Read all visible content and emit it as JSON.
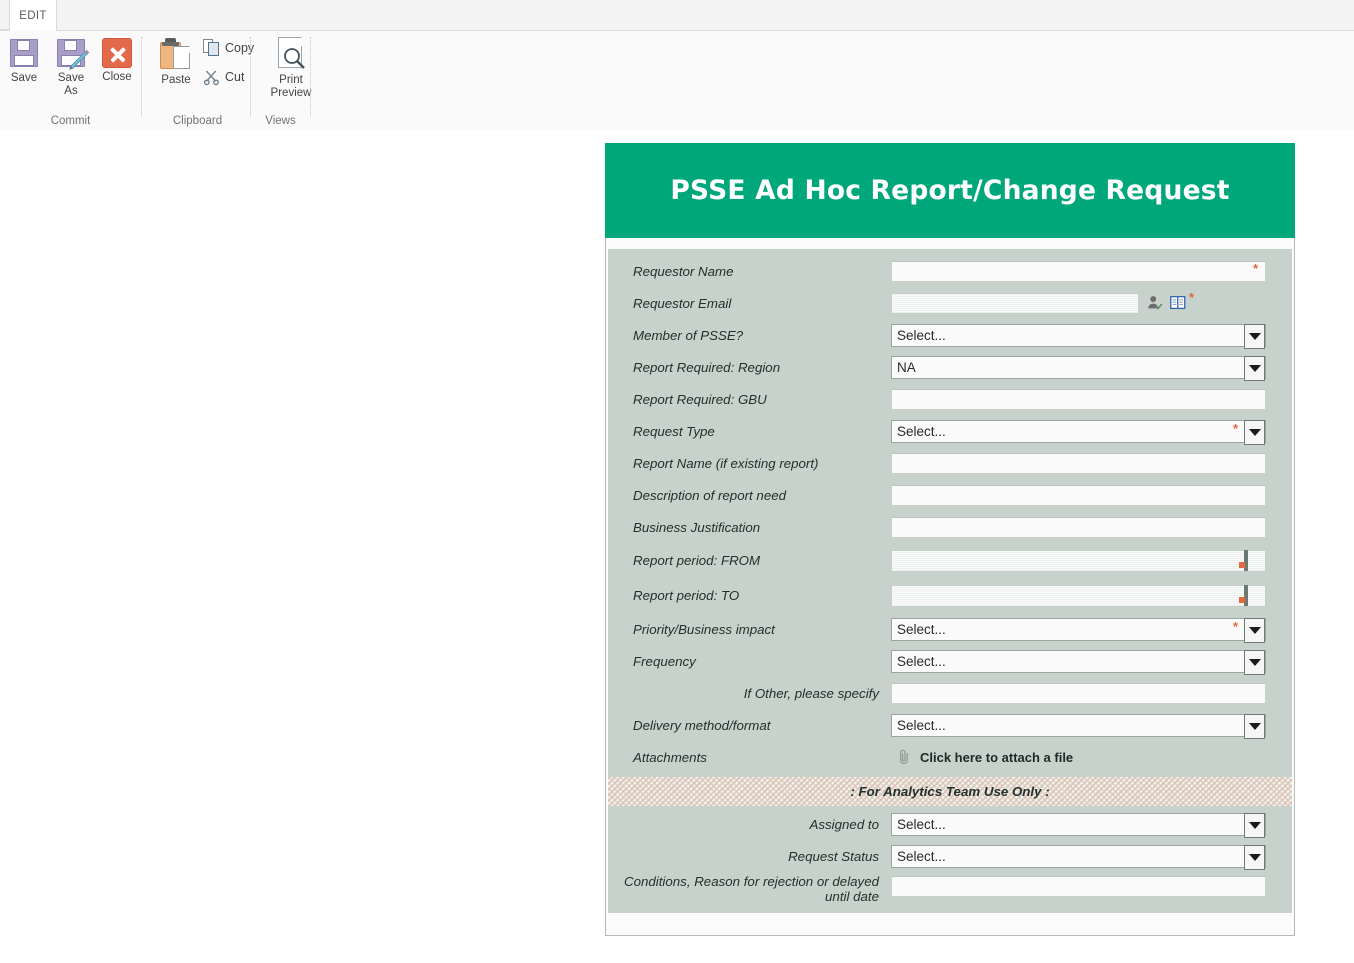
{
  "ribbon": {
    "tabs": [
      {
        "label": "EDIT"
      }
    ],
    "groups": [
      {
        "title": "Commit",
        "buttons": [
          {
            "label": "Save",
            "icon": "floppy-disk-icon"
          },
          {
            "label": "Save\nAs",
            "line1": "Save",
            "line2": "As",
            "icon": "floppy-disk-pencil-icon"
          },
          {
            "label": "Close",
            "icon": "close-x-icon"
          }
        ]
      },
      {
        "title": "Clipboard",
        "buttons": [
          {
            "label": "Paste",
            "icon": "clipboard-icon"
          },
          {
            "label": "Copy",
            "icon": "copy-icon"
          },
          {
            "label": "Cut",
            "icon": "scissors-icon"
          }
        ]
      },
      {
        "title": "Views",
        "buttons": [
          {
            "line1": "Print",
            "line2": "Preview",
            "icon": "print-preview-icon"
          }
        ]
      }
    ]
  },
  "form": {
    "title": "PSSE Ad Hoc Report/Change Request",
    "header_color": "#00a77b",
    "body_color": "#c6d2cb",
    "required_marker": "*",
    "required_color": "#e3663f",
    "select_placeholder": "Select...",
    "rows": [
      {
        "label": "Requestor Name",
        "type": "text",
        "value": "",
        "required": true
      },
      {
        "label": "Requestor Email",
        "type": "people",
        "value": "",
        "required": true,
        "icons": [
          "check-names-icon",
          "address-book-icon"
        ]
      },
      {
        "label": "Member of PSSE?",
        "type": "select",
        "value": "Select...",
        "required": false
      },
      {
        "label": "Report Required: Region",
        "type": "select",
        "value": "NA",
        "required": false
      },
      {
        "label": "Report Required: GBU",
        "type": "text",
        "value": "",
        "required": false
      },
      {
        "label": "Request Type",
        "type": "select",
        "value": "Select...",
        "required": true
      },
      {
        "label": "Report Name (if existing report)",
        "type": "text",
        "value": "",
        "required": false
      },
      {
        "label": "Description of report need",
        "type": "text",
        "value": "",
        "required": false
      },
      {
        "label": "Business Justification",
        "type": "text",
        "value": "",
        "required": false
      },
      {
        "label": "Report period: FROM",
        "type": "date",
        "value": "",
        "required": false
      },
      {
        "label": "Report period: TO",
        "type": "date",
        "value": "",
        "required": false
      },
      {
        "label": "Priority/Business impact",
        "type": "select",
        "value": "Select...",
        "required": true
      },
      {
        "label": "Frequency",
        "type": "select",
        "value": "Select...",
        "required": false
      },
      {
        "label": "If Other, please specify",
        "type": "text",
        "value": "",
        "required": false,
        "align": "right"
      },
      {
        "label": "Delivery method/format",
        "type": "select",
        "value": "Select...",
        "required": false
      },
      {
        "label": "Attachments",
        "type": "attach",
        "value": "Click here to attach a file",
        "required": false
      }
    ],
    "banner": {
      "text": ": For Analytics Team Use Only :"
    },
    "admin_rows": [
      {
        "label": "Assigned to",
        "type": "select",
        "value": "Select...",
        "align": "right"
      },
      {
        "label": "Request Status",
        "type": "select",
        "value": "Select...",
        "align": "right"
      },
      {
        "label": "Conditions, Reason for rejection or delayed until date",
        "type": "text",
        "value": "",
        "align": "right"
      }
    ]
  }
}
